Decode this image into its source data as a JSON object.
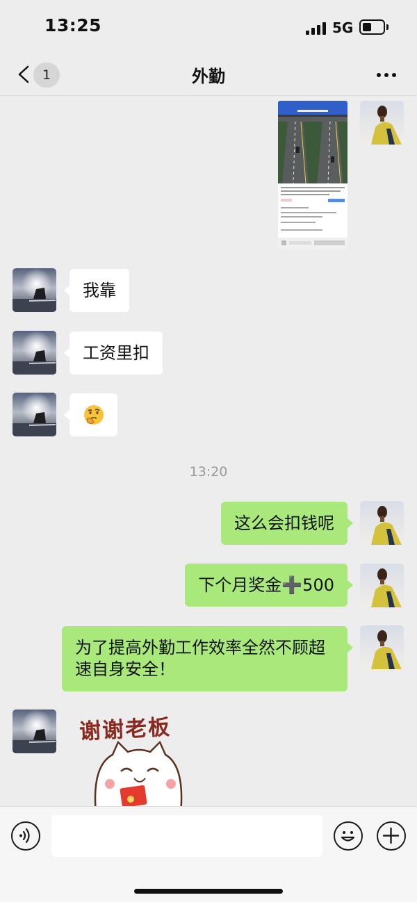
{
  "status_bar": {
    "time": "13:25",
    "network": "5G"
  },
  "nav": {
    "unread_count": "1",
    "title": "外勤"
  },
  "messages": [
    {
      "side": "left",
      "text": "我靠"
    },
    {
      "side": "left",
      "text": "工资里扣"
    },
    {
      "side": "left",
      "emoji": "🤔"
    },
    {
      "side": "right",
      "text": "这么会扣钱呢"
    },
    {
      "side": "right",
      "text": "下个月奖金➕500"
    },
    {
      "side": "right",
      "text": "为了提高外勤工作效率全然不顾超速自身安全！"
    }
  ],
  "time_separator": "13:20",
  "sticker": {
    "caption": "谢谢老板"
  },
  "input": {
    "value": ""
  },
  "colors": {
    "background": "#ededed",
    "bubble_green": "#a9e87a",
    "bubble_white": "#ffffff"
  },
  "icons": [
    "chevron-left-icon",
    "more-icon",
    "voice-icon",
    "emoji-icon",
    "plus-icon"
  ]
}
